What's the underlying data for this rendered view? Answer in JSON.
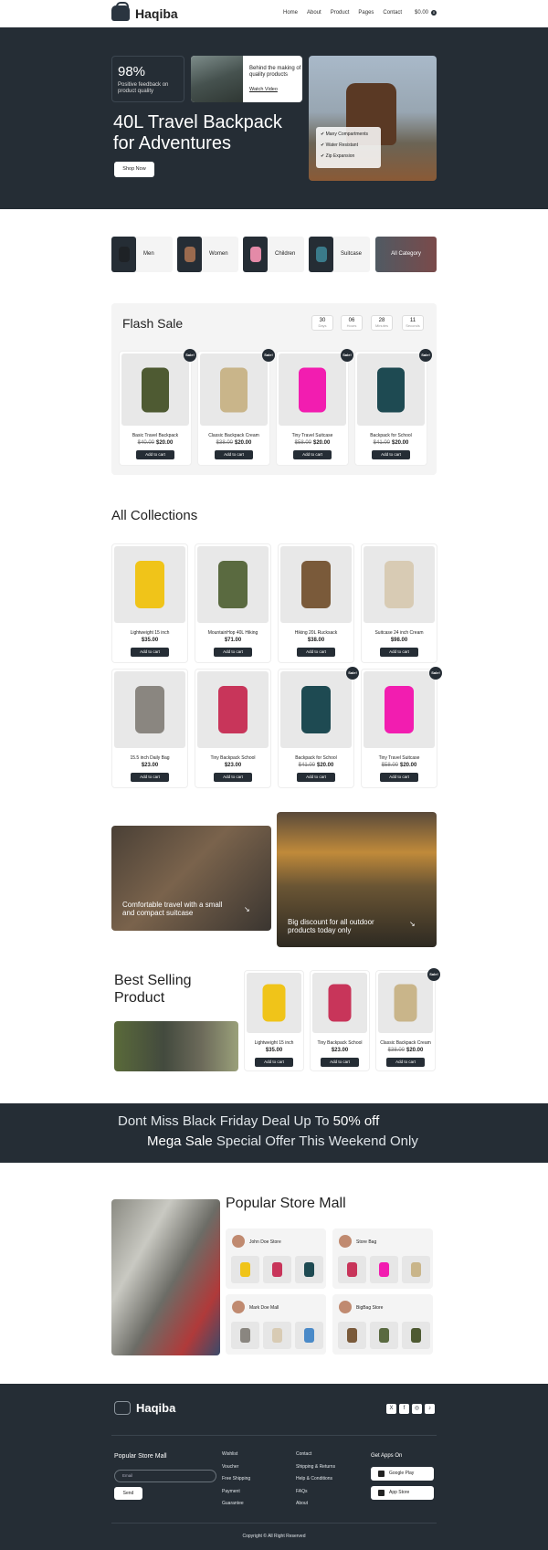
{
  "header": {
    "brand": "Haqiba",
    "nav": [
      "Home",
      "About",
      "Product",
      "Pages",
      "Contact"
    ],
    "cart_total": "$0.00",
    "cart_count": "0"
  },
  "hero": {
    "stat_value": "98%",
    "stat_label": "Positive feedback on product quality",
    "video_card_text": "Behind the making of quality products",
    "video_link": "Watch Video",
    "title": "40L Travel Backpack for Adventures",
    "cta": "Shop Now",
    "features": [
      "Many Compartments",
      "Water Resistant",
      "Zip Expansion"
    ]
  },
  "categories": [
    {
      "label": "Men",
      "color": "#1e2226"
    },
    {
      "label": "Women",
      "color": "#9a6a4e"
    },
    {
      "label": "Children",
      "color": "#e48aa8"
    },
    {
      "label": "Suitcase",
      "color": "#3a7a8a"
    }
  ],
  "all_category": "All Category",
  "flash_sale": {
    "title": "Flash Sale",
    "countdown": [
      {
        "value": "30",
        "unit": "Days"
      },
      {
        "value": "06",
        "unit": "Hours"
      },
      {
        "value": "28",
        "unit": "Minutes"
      },
      {
        "value": "11",
        "unit": "Seconds"
      }
    ],
    "badge": "Sale!",
    "button": "Add to cart",
    "products": [
      {
        "name": "Basic Travel Backpack",
        "old_price": "$40.00",
        "price": "$20.00",
        "color": "#4e5a32"
      },
      {
        "name": "Classic Backpack Cream",
        "old_price": "$38.00",
        "price": "$20.00",
        "color": "#c9b58a"
      },
      {
        "name": "Tiny Travel Suitcase",
        "old_price": "$58.00",
        "price": "$20.00",
        "color": "#f21db0"
      },
      {
        "name": "Backpack for School",
        "old_price": "$41.00",
        "price": "$20.00",
        "color": "#1e4a52"
      }
    ]
  },
  "collections": {
    "title": "All Collections",
    "button": "Add to cart",
    "badge": "Sale!",
    "products": [
      {
        "name": "Lightweight 15 inch",
        "old_price": "",
        "price": "$35.00",
        "color": "#f0c419",
        "sale": false
      },
      {
        "name": "MountainHop 40L Hiking",
        "old_price": "",
        "price": "$71.00",
        "color": "#5a6a40",
        "sale": false
      },
      {
        "name": "Hiking 20L Rucksack",
        "old_price": "",
        "price": "$38.00",
        "color": "#7a5a3a",
        "sale": false
      },
      {
        "name": "Suitcase 24 inch Cream",
        "old_price": "",
        "price": "$98.00",
        "color": "#d8cbb4",
        "sale": false
      },
      {
        "name": "15.5 inch Daily Bag",
        "old_price": "",
        "price": "$23.00",
        "color": "#8a8680",
        "sale": false
      },
      {
        "name": "Tiny Backpack School",
        "old_price": "",
        "price": "$23.00",
        "color": "#c8355a",
        "sale": false
      },
      {
        "name": "Backpack for School",
        "old_price": "$41.00",
        "price": "$20.00",
        "color": "#1e4a52",
        "sale": true
      },
      {
        "name": "Tiny Travel Suitcase",
        "old_price": "$58.00",
        "price": "$20.00",
        "color": "#f21db0",
        "sale": true
      }
    ]
  },
  "banners": [
    {
      "text": "Comfortable travel with a small and compact suitcase"
    },
    {
      "text": "Big discount for all outdoor products today only"
    }
  ],
  "best_selling": {
    "title": "Best Selling Product",
    "button": "Add to cart",
    "badge": "Sale!",
    "products": [
      {
        "name": "Lightweight 15 inch",
        "old_price": "",
        "price": "$35.00",
        "color": "#f0c419",
        "sale": false
      },
      {
        "name": "Tiny Backpack School",
        "old_price": "",
        "price": "$23.00",
        "color": "#c8355a",
        "sale": false
      },
      {
        "name": "Classic Backpack Cream",
        "old_price": "$38.00",
        "price": "$20.00",
        "color": "#c9b58a",
        "sale": true
      }
    ]
  },
  "promo": {
    "line1_pre": "Dont Miss Black Friday Deal Up To ",
    "line1_bold": "50% off",
    "line2_bold": "Mega Sale",
    "line2_post": " Special Offer This Weekend Only"
  },
  "popular": {
    "title": "Popular Store Mall",
    "stores": [
      {
        "name": "John Doe Store",
        "thumbs": [
          "#f0c419",
          "#c8355a",
          "#1e4a52"
        ]
      },
      {
        "name": "Store Bag",
        "thumbs": [
          "#c8355a",
          "#f21db0",
          "#c9b58a"
        ]
      },
      {
        "name": "Mark Doe Mall",
        "thumbs": [
          "#8a8680",
          "#d8cbb4",
          "#4a8ac8"
        ]
      },
      {
        "name": "BigBag Store",
        "thumbs": [
          "#7a5a3a",
          "#5a6a40",
          "#4e5a32"
        ]
      }
    ]
  },
  "footer": {
    "brand": "Haqiba",
    "newsletter_title": "Popular Store Mall",
    "email_placeholder": "Email",
    "send": "Send",
    "col1": [
      "Wishlist",
      "Voucher",
      "Free Shipping",
      "Payment",
      "Guarantee"
    ],
    "col2": [
      "Contact",
      "Shipping & Returns",
      "Help & Conditions",
      "FAQs",
      "About"
    ],
    "apps_title": "Get Apps On",
    "apps": [
      "Google Play",
      "App Store"
    ],
    "social": [
      "X",
      "f",
      "◎",
      "♪"
    ],
    "copyright": "Copyright © All Right Reserved"
  }
}
